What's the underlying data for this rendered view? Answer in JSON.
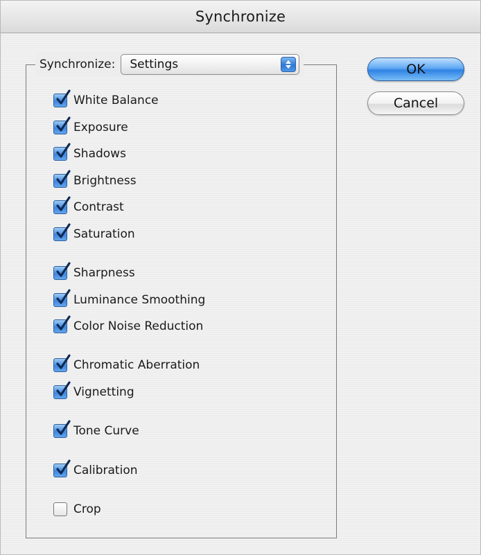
{
  "window": {
    "title": "Synchronize"
  },
  "group": {
    "label": "Synchronize:",
    "popup_value": "Settings"
  },
  "buttons": {
    "ok_label": "OK",
    "cancel_label": "Cancel"
  },
  "checkboxes": [
    {
      "label": "White Balance",
      "checked": true
    },
    {
      "label": "Exposure",
      "checked": true
    },
    {
      "label": "Shadows",
      "checked": true
    },
    {
      "label": "Brightness",
      "checked": true
    },
    {
      "label": "Contrast",
      "checked": true
    },
    {
      "label": "Saturation",
      "checked": true
    },
    {
      "label": "Sharpness",
      "checked": true
    },
    {
      "label": "Luminance Smoothing",
      "checked": true
    },
    {
      "label": "Color Noise Reduction",
      "checked": true
    },
    {
      "label": "Chromatic Aberration",
      "checked": true
    },
    {
      "label": "Vignetting",
      "checked": true
    },
    {
      "label": "Tone Curve",
      "checked": true
    },
    {
      "label": "Calibration",
      "checked": true
    },
    {
      "label": "Crop",
      "checked": false
    }
  ],
  "colors": {
    "accent": "#3f86de",
    "window_bg": "#ededed"
  }
}
